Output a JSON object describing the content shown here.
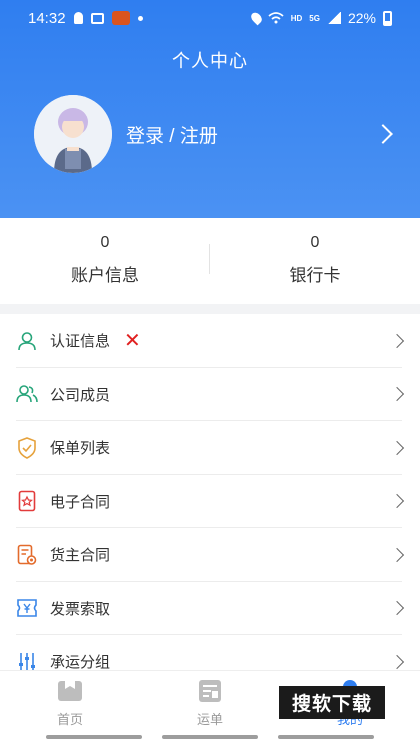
{
  "status_bar": {
    "time": "14:32",
    "hd": "HD",
    "network": "5G",
    "battery": "22%"
  },
  "header": {
    "title": "个人中心"
  },
  "profile": {
    "login_text": "登录 / 注册"
  },
  "stats": [
    {
      "value": "0",
      "label": "账户信息"
    },
    {
      "value": "0",
      "label": "银行卡"
    }
  ],
  "menu": [
    {
      "label": "认证信息",
      "icon": "user-icon",
      "color": "#27a57a",
      "error": "✕"
    },
    {
      "label": "公司成员",
      "icon": "users-icon",
      "color": "#27a57a"
    },
    {
      "label": "保单列表",
      "icon": "shield-icon",
      "color": "#e6a23c"
    },
    {
      "label": "电子合同",
      "icon": "contract-icon",
      "color": "#e23b3b"
    },
    {
      "label": "货主合同",
      "icon": "document-icon",
      "color": "#e36b2c"
    },
    {
      "label": "发票索取",
      "icon": "invoice-icon",
      "color": "#3a86e8"
    },
    {
      "label": "承运分组",
      "icon": "sliders-icon",
      "color": "#3a86e8"
    }
  ],
  "tabs": [
    {
      "label": "首页",
      "icon": "home-icon"
    },
    {
      "label": "运单",
      "icon": "waybill-icon"
    },
    {
      "label": "我的",
      "icon": "profile-icon"
    }
  ],
  "watermark": "搜软下载",
  "colors": {
    "primary": "#2f7ef0",
    "error": "#e02020"
  }
}
